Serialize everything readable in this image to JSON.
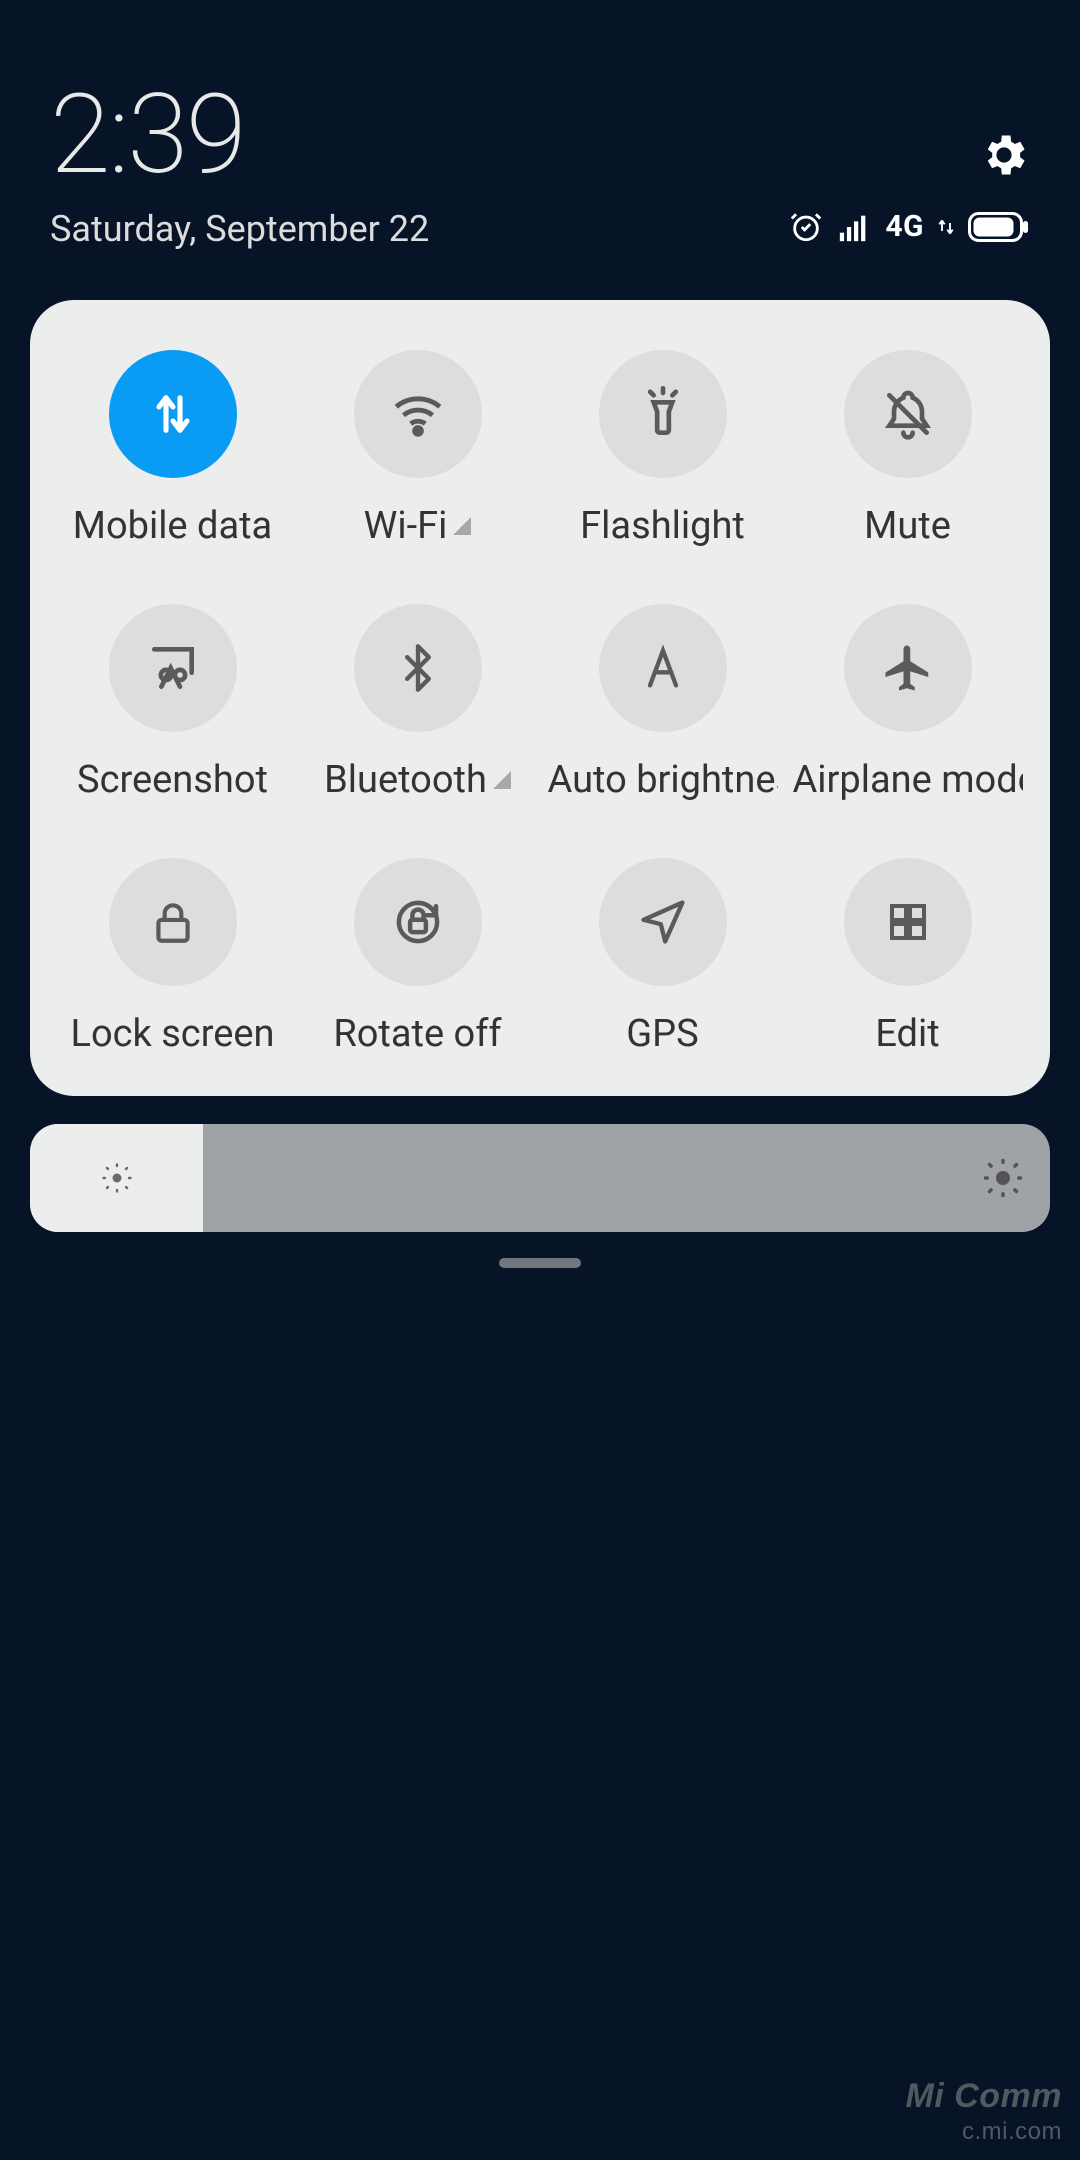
{
  "header": {
    "time": "2:39",
    "date": "Saturday, September 22",
    "network_label": "4G"
  },
  "tiles": [
    {
      "label": "Mobile data",
      "icon": "mobile-data",
      "active": true,
      "indicator": false
    },
    {
      "label": "Wi-Fi",
      "icon": "wifi",
      "active": false,
      "indicator": true
    },
    {
      "label": "Flashlight",
      "icon": "flashlight",
      "active": false,
      "indicator": false
    },
    {
      "label": "Mute",
      "icon": "mute",
      "active": false,
      "indicator": false
    },
    {
      "label": "Screenshot",
      "icon": "screenshot",
      "active": false,
      "indicator": false
    },
    {
      "label": "Bluetooth",
      "icon": "bluetooth",
      "active": false,
      "indicator": true
    },
    {
      "label": "Auto brightness",
      "icon": "auto-brightness",
      "active": false,
      "indicator": false
    },
    {
      "label": "Airplane mode",
      "icon": "airplane",
      "active": false,
      "indicator": false
    },
    {
      "label": "Lock screen",
      "icon": "lock",
      "active": false,
      "indicator": false
    },
    {
      "label": "Rotate off",
      "icon": "rotate-off",
      "active": false,
      "indicator": false
    },
    {
      "label": "GPS",
      "icon": "gps",
      "active": false,
      "indicator": false
    },
    {
      "label": "Edit",
      "icon": "edit",
      "active": false,
      "indicator": false
    }
  ],
  "brightness": {
    "percent": 17
  },
  "watermark": {
    "line1": "Mi Comm",
    "line2": "c.mi.com"
  }
}
